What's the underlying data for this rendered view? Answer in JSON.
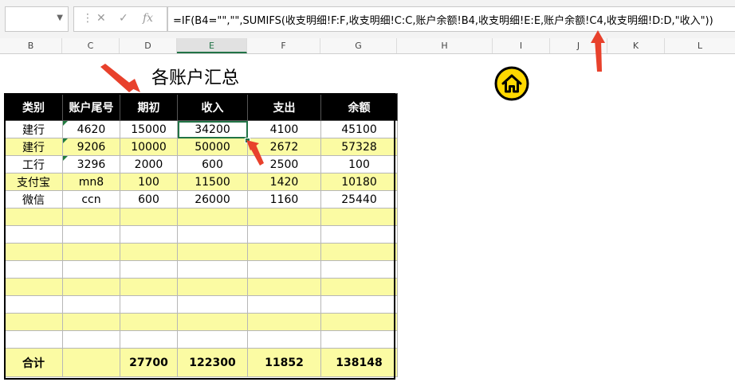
{
  "formula_bar": {
    "fx_label": "fx",
    "cancel_icon": "x-icon",
    "enter_icon": "check-icon",
    "formula": "=IF(B4=\"\",\"\",SUMIFS(收支明细!F:F,收支明细!C:C,账户余额!B4,收支明细!E:E,账户余额!C4,收支明细!D:D,\"收入\"))"
  },
  "columns": [
    "B",
    "C",
    "D",
    "E",
    "F",
    "G",
    "H",
    "I",
    "J",
    "K",
    "L"
  ],
  "title": "各账户汇总",
  "table": {
    "headers": [
      "类别",
      "账户尾号",
      "期初",
      "收入",
      "支出",
      "余额"
    ],
    "rows": [
      [
        "建行",
        "4620",
        "15000",
        "34200",
        "4100",
        "45100"
      ],
      [
        "建行",
        "9206",
        "10000",
        "50000",
        "2672",
        "57328"
      ],
      [
        "工行",
        "3296",
        "2000",
        "600",
        "2500",
        "100"
      ],
      [
        "支付宝",
        "mn8",
        "100",
        "11500",
        "1420",
        "10180"
      ],
      [
        "微信",
        "ccn",
        "600",
        "26000",
        "1160",
        "25440"
      ]
    ],
    "totals": [
      "合计",
      "",
      "27700",
      "122300",
      "11852",
      "138148"
    ]
  },
  "colors": {
    "header_bg": "#000000",
    "band_yellow": "#fbfba3",
    "accent_green": "#217346",
    "arrow_red": "#e8412c",
    "home_icon": "#ffd800"
  },
  "home_icon": "home-icon"
}
